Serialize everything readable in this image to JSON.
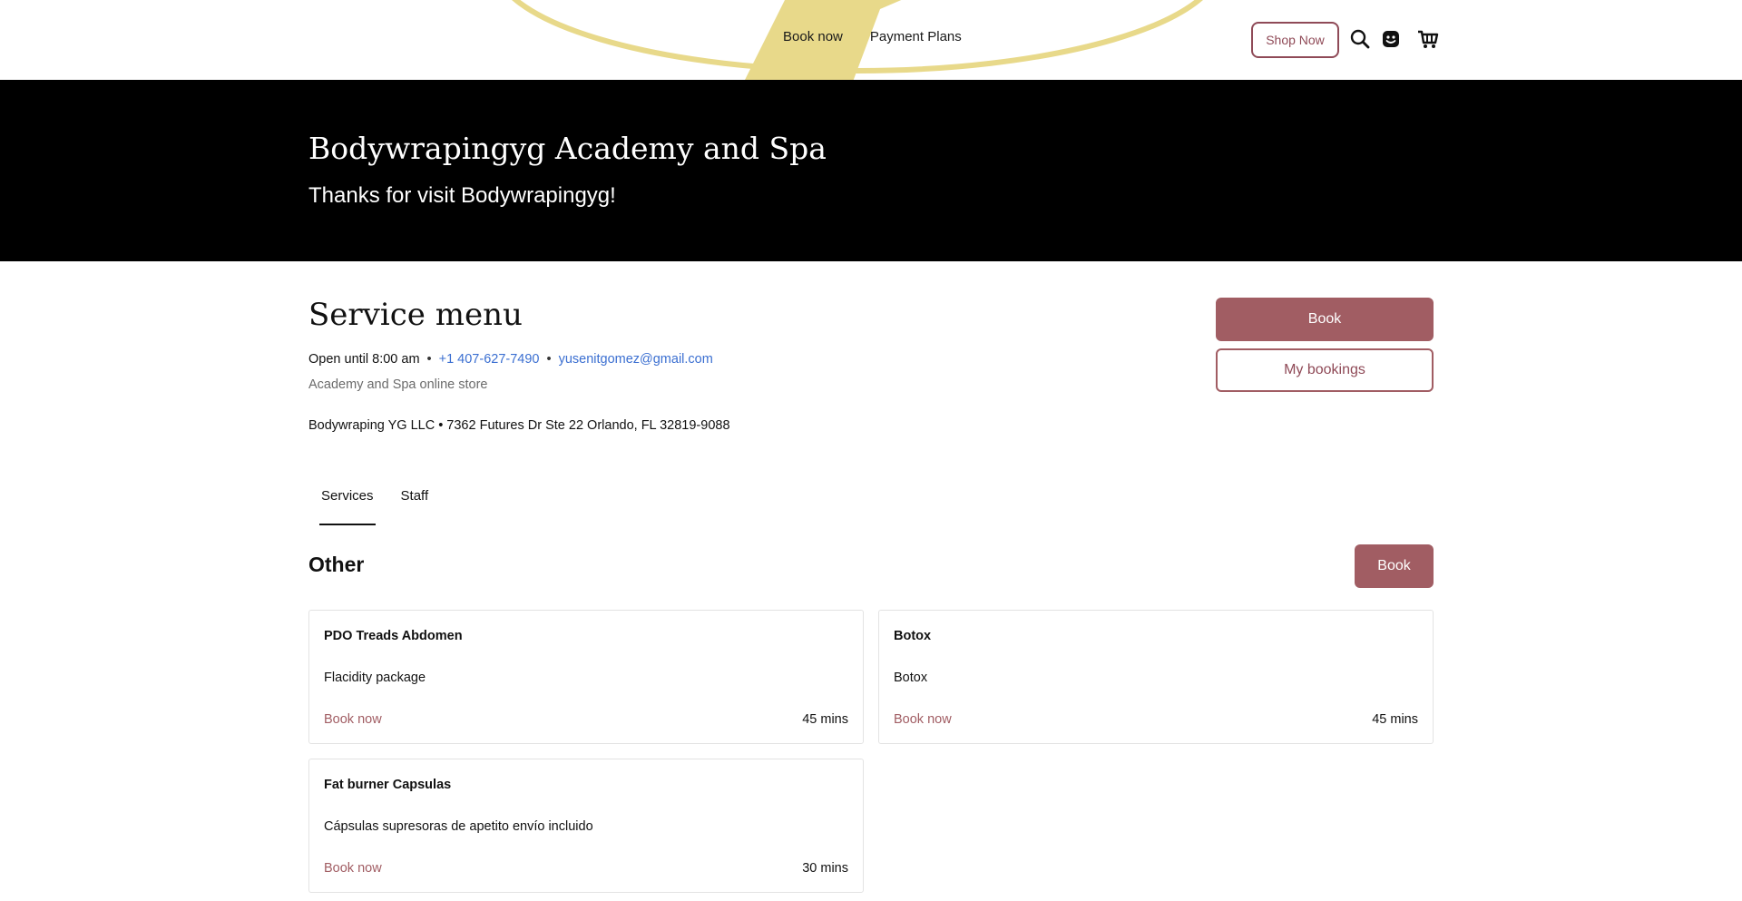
{
  "header": {
    "nav": [
      "Book now",
      "Payment Plans"
    ],
    "shop_now": "Shop Now",
    "icons": [
      "search-icon",
      "account-icon",
      "cart-icon"
    ],
    "logo_color": "#e8d98a"
  },
  "hero": {
    "title": "Bodywrapingyg Academy and Spa",
    "subtitle": "Thanks for visit Bodywrapingyg!"
  },
  "service_menu": {
    "title": "Service menu",
    "hours": "Open until 8:00 am",
    "separator": "•",
    "phone": "+1 407-627-7490",
    "email": "yusenitgomez@gmail.com",
    "store_text": "Academy and Spa online store",
    "address": "Bodywraping YG LLC • 7362 Futures Dr Ste 22 Orlando, FL 32819-9088",
    "book_label": "Book",
    "my_bookings_label": "My bookings"
  },
  "tabs": [
    "Services",
    "Staff"
  ],
  "category": {
    "title": "Other",
    "book_label": "Book",
    "services": [
      {
        "name": "PDO Treads Abdomen",
        "description": "Flacidity package",
        "book": "Book now",
        "duration": "45 mins"
      },
      {
        "name": "Botox",
        "description": "Botox",
        "book": "Book now",
        "duration": "45 mins"
      },
      {
        "name": "Fat burner Capsulas",
        "description": "Cápsulas supresoras de apetito envío incluido",
        "book": "Book now",
        "duration": "30 mins"
      }
    ]
  },
  "colors": {
    "accent": "#a15d63",
    "link": "#3b6fd1",
    "hero_bg": "#000000"
  }
}
